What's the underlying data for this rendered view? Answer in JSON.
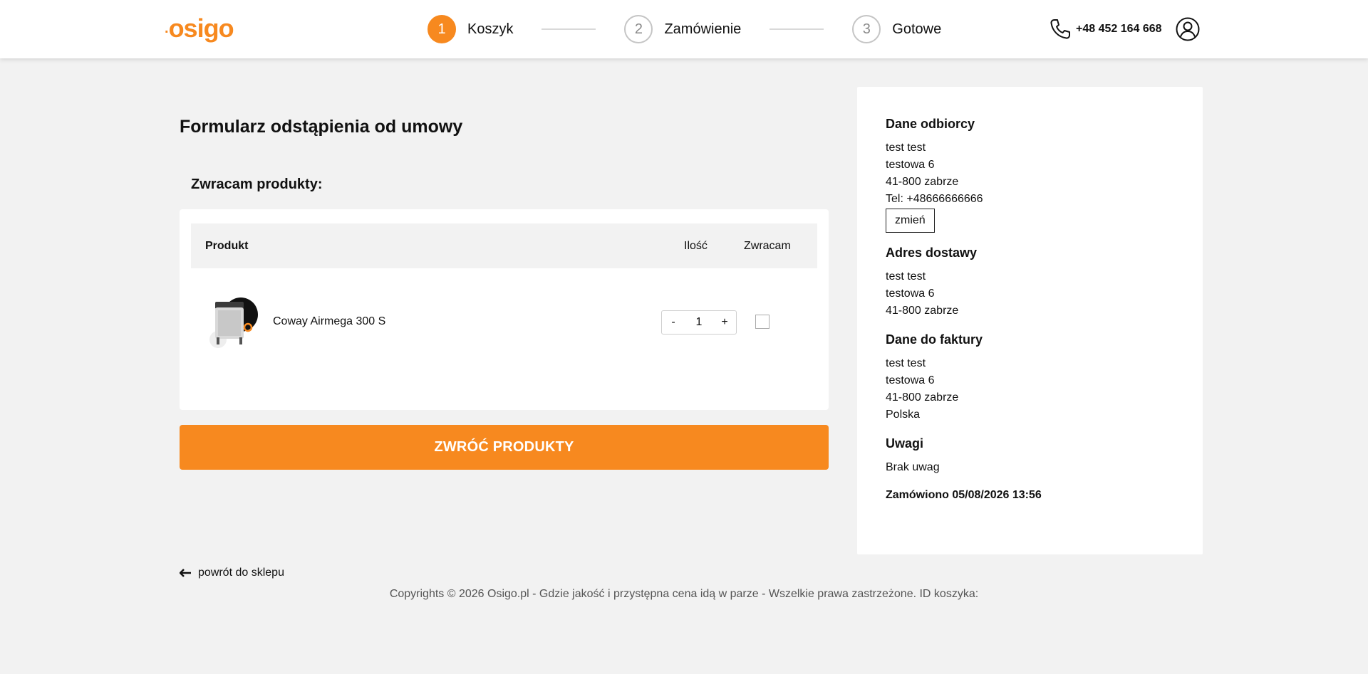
{
  "brand": {
    "logo_text": "osigo",
    "accent_color": "#f7891f"
  },
  "steps": [
    {
      "number": "1",
      "label": "Koszyk",
      "active": true
    },
    {
      "number": "2",
      "label": "Zamówienie",
      "active": false
    },
    {
      "number": "3",
      "label": "Gotowe",
      "active": false
    }
  ],
  "header": {
    "phone": "+48 452 164 668",
    "phone_icon": "phone-icon",
    "user_icon": "user-account-icon"
  },
  "main": {
    "title": "Formularz odstąpienia od umowy",
    "section_title": "Zwracam produkty:",
    "table": {
      "headers": {
        "product": "Produkt",
        "quantity": "Ilość",
        "return": "Zwracam"
      },
      "rows": [
        {
          "name": "Coway Airmega 300 S",
          "quantity": "1",
          "minus": "-",
          "plus": "+",
          "returning": false
        }
      ]
    },
    "submit_label": "ZWRÓĆ PRODUKTY"
  },
  "sidebar": {
    "recipient": {
      "title": "Dane odbiorcy",
      "lines": [
        "test test",
        "testowa 6",
        "41-800 zabrze",
        "Tel: +48666666666"
      ],
      "change_label": "zmień"
    },
    "delivery": {
      "title": "Adres dostawy",
      "lines": [
        "test test",
        "testowa 6",
        "41-800 zabrze"
      ]
    },
    "invoice": {
      "title": "Dane do faktury",
      "lines": [
        "test test",
        "testowa 6",
        "41-800 zabrze",
        "Polska"
      ]
    },
    "notes": {
      "title": "Uwagi",
      "text": "Brak uwag"
    },
    "ordered": "Zamówiono 05/08/2026 13:56"
  },
  "footer": {
    "back_label": "powrót do sklepu",
    "copyright": "Copyrights © 2026 Osigo.pl - Gdzie jakość i przystępna cena idą w parze - Wszelkie prawa zastrzeżone. ID koszyka:"
  }
}
